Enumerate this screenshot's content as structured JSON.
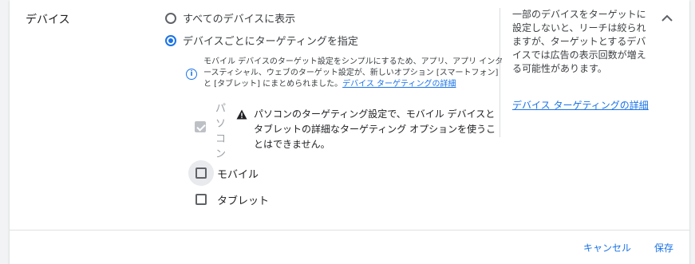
{
  "section": {
    "title": "デバイス"
  },
  "radio_options": [
    {
      "label": "すべてのデバイスに表示",
      "checked": false
    },
    {
      "label": "デバイスごとにターゲティングを指定",
      "checked": true
    }
  ],
  "info": {
    "text": "モバイル デバイスのターゲット設定をシンプルにするため、アプリ、アプリ インタースティシャル、ウェブのターゲット設定が、新しいオプション [スマートフォン] と [タブレット] にまとめられました。",
    "link": "デバイス ターゲティングの詳細"
  },
  "devices": {
    "pc_label": "パソコン",
    "pc_checked": true,
    "pc_warning": "パソコンのターゲティング設定で、モバイル デバイスとタブレットの詳細なターゲティング オプションを使うことはできません。",
    "mobile_label": "モバイル",
    "mobile_checked": false,
    "tablet_label": "タブレット",
    "tablet_checked": false
  },
  "side_help": {
    "text": "一部のデバイスをターゲットに設定しないと、リーチは絞られますが、ターゲットとするデバイスでは広告の表示回数が増える可能性があります。",
    "link": "デバイス ターゲティングの詳細"
  },
  "footer": {
    "cancel": "キャンセル",
    "save": "保存"
  },
  "colors": {
    "accent": "#1a73e8",
    "warning": "#202124",
    "disabled": "#bdc1c6"
  }
}
